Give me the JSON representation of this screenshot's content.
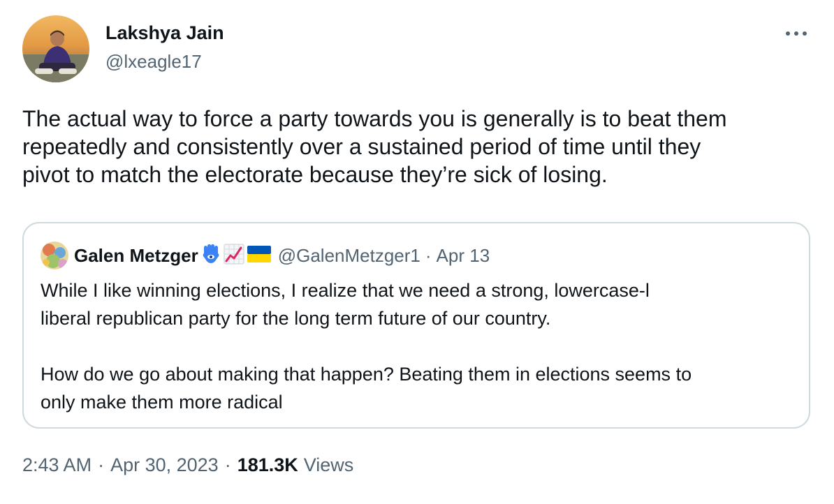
{
  "author": {
    "name": "Lakshya Jain",
    "handle": "@lxeagle17"
  },
  "tweet": {
    "lines": [
      "The actual way to force a party towards you is generally is to beat them",
      "repeatedly and consistently over a sustained period of time until they",
      "pivot to match the electorate because they’re sick of losing."
    ]
  },
  "quoted_tweet": {
    "name": "Galen Metzger",
    "name_emojis": [
      "hamsa-icon",
      "chart-increasing-icon",
      "ukraine-flag-icon"
    ],
    "handle": "@GalenMetzger1",
    "separator": "·",
    "date": "Apr 13",
    "paragraph1": [
      "While I like winning elections, I realize that we need a strong, lowercase-l",
      "liberal republican party for the long term future of our country."
    ],
    "paragraph2": [
      "How do we go about making that happen? Beating them in elections seems to",
      "only make them more radical"
    ]
  },
  "meta": {
    "time": "2:43 AM",
    "separator": "·",
    "date": "Apr 30, 2023",
    "views_count": "181.3K",
    "views_label": "Views"
  },
  "more_icon": "more-horizontal-icon",
  "colors": {
    "text_primary": "#0f1419",
    "text_secondary": "#536471",
    "border": "#cfd9de",
    "hamsa_blue": "#3b82f6",
    "chart_red": "#e0245e",
    "flag_blue": "#0057b7",
    "flag_yellow": "#ffd700"
  }
}
